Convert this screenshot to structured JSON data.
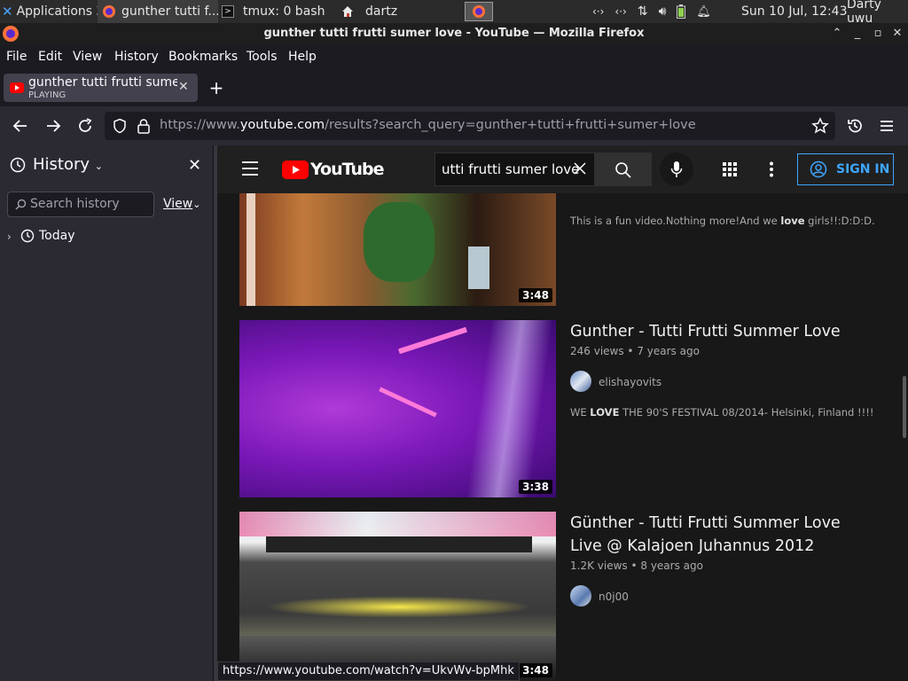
{
  "taskbar": {
    "applications_label": "Applications",
    "apps_shortcut": "3",
    "tasks": [
      {
        "label": "gunther tutti f..."
      },
      {
        "label": "tmux: 0 bash"
      },
      {
        "label": "dartz"
      }
    ],
    "clock": "Sun 10 Jul, 12:43",
    "user": "Darty uwu"
  },
  "window": {
    "title": "gunther tutti frutti sumer love - YouTube — Mozilla Firefox"
  },
  "menubar": {
    "file": "File",
    "edit": "Edit",
    "view": "View",
    "history": "History",
    "bookmarks": "Bookmarks",
    "tools": "Tools",
    "help": "Help"
  },
  "tab": {
    "title": "gunther tutti frutti sumer love - YouTube",
    "status": "PLAYING"
  },
  "navbar": {
    "url_prefix": "https://www.",
    "url_domain": "youtube.com",
    "url_path": "/results?search_query=gunther+tutti+frutti+sumer+love"
  },
  "sidebar": {
    "title": "History",
    "search_placeholder": "Search history",
    "view_label": "View",
    "groups": [
      {
        "label": "Today"
      }
    ]
  },
  "youtube": {
    "logo_text": "YouTube",
    "search_query": "utti frutti sumer love",
    "sign_in": "SIGN IN",
    "results": [
      {
        "duration": "3:48",
        "description_pre": "This is a fun video.Nothing more!And we ",
        "description_bold": "love",
        "description_post": " girls!!:D:D:D."
      },
      {
        "title": "Gunther - Tutti Frutti Summer Love",
        "views": "246 views",
        "age": "7 years ago",
        "channel": "elishayovits",
        "duration": "3:38",
        "description_pre": "WE ",
        "description_bold": "LOVE",
        "description_post": " THE 90'S FESTIVAL 08/2014- Helsinki, Finland !!!!"
      },
      {
        "title_line1": "Günther - Tutti Frutti Summer Love",
        "title_line2": "Live @ Kalajoen Juhannus 2012",
        "views": "1.2K views",
        "age": "8 years ago",
        "channel": "n0j00",
        "duration": "3:48"
      }
    ]
  },
  "status_url": "https://www.youtube.com/watch?v=UkvWv-bpMhk",
  "colors": {
    "youtube_red": "#ff0000",
    "signin_blue": "#3ea6ff",
    "firefox_dark": "#1c1b22"
  }
}
